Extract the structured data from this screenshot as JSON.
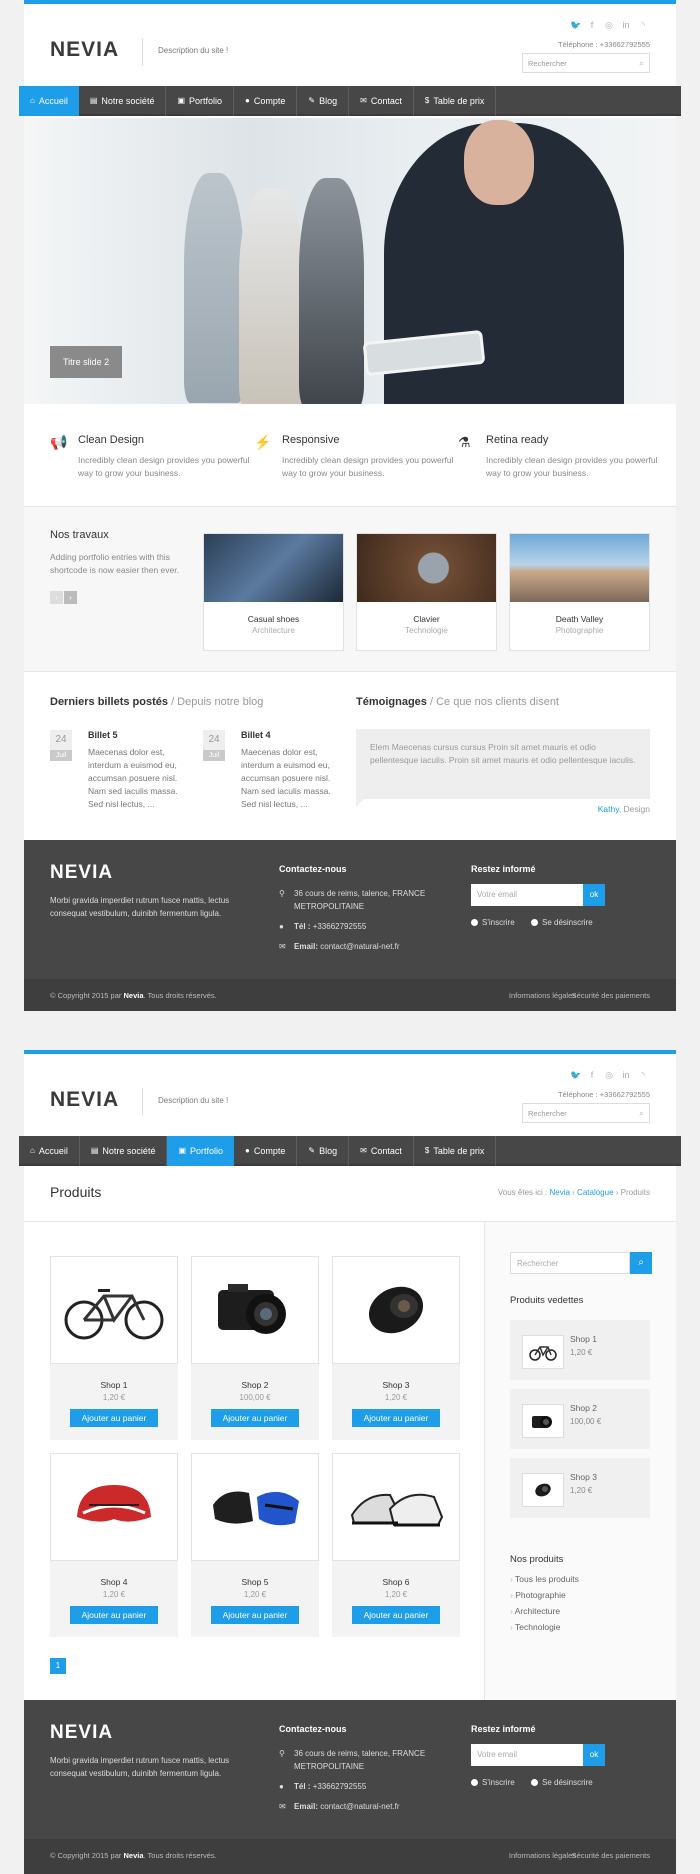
{
  "site": {
    "logo": "NEVIA",
    "description": "Description du site !",
    "phone": "Téléphone : +33662792555",
    "search_placeholder": "Rechercher"
  },
  "social_icons": [
    "twitter-icon",
    "facebook-icon",
    "dribbble-icon",
    "linkedin-icon",
    "rss-icon"
  ],
  "nav": {
    "items": [
      {
        "icon": "home-icon",
        "label": "Accueil"
      },
      {
        "icon": "file-icon",
        "label": "Notre société"
      },
      {
        "icon": "briefcase-icon",
        "label": "Portfolio"
      },
      {
        "icon": "user-icon",
        "label": "Compte"
      },
      {
        "icon": "pencil-icon",
        "label": "Blog"
      },
      {
        "icon": "envelope-icon",
        "label": "Contact"
      },
      {
        "icon": "dollar-icon",
        "label": "Table de prix"
      }
    ],
    "active_page1": "Accueil",
    "active_page2": "Portfolio"
  },
  "hero": {
    "slide_title": "Titre slide 2"
  },
  "features": [
    {
      "icon": "megaphone-icon",
      "title": "Clean Design",
      "text": "Incredibly clean design provides you powerful way to grow your business."
    },
    {
      "icon": "magic-wand-icon",
      "title": "Responsive",
      "text": "Incredibly clean design provides you powerful way to grow your business."
    },
    {
      "icon": "flask-icon",
      "title": "Retina ready",
      "text": "Incredibly clean design provides you powerful way to grow your business."
    }
  ],
  "portfolio": {
    "title": "Nos travaux",
    "text": "Adding portfolio entries with this shortcode is now easier then ever.",
    "items": [
      {
        "title": "Casual shoes",
        "category": "Architecture"
      },
      {
        "title": "Clavier",
        "category": "Technologie"
      },
      {
        "title": "Death Valley",
        "category": "Photographie"
      }
    ]
  },
  "blog": {
    "title": "Derniers billets postés",
    "subtitle": "/ Depuis notre blog",
    "posts": [
      {
        "day": "24",
        "month": "Juil",
        "title": "Billet 5",
        "excerpt": "Maecenas dolor est, interdum a euismod eu, accumsan posuere nisl. Nam sed iaculis massa. Sed nisl lectus, ..."
      },
      {
        "day": "24",
        "month": "Juil",
        "title": "Billet 4",
        "excerpt": "Maecenas dolor est, interdum a euismod eu, accumsan posuere nisl. Nam sed iaculis massa. Sed nisl lectus, ..."
      }
    ]
  },
  "testimonials": {
    "title": "Témoignages",
    "subtitle": "/ Ce que nos clients disent",
    "quote": "Elem Maecenas cursus cursus Proin sit amet mauris et odio pellentesque iaculis. Proin sit amet mauris et odio pellentesque iaculis.",
    "author": "Kathy",
    "role": ", Design"
  },
  "footer": {
    "logo": "NEVIA",
    "about": "Morbi gravida imperdiet rutrum fusce mattis, lectus consequat vestibulum, duinibh fermentum ligula.",
    "contact_title": "Contactez-nous",
    "address": "36 cours de reims, talence, FRANCE METROPOLITAINE",
    "tel_label": "Tél :",
    "tel": "+33662792555",
    "email_label": "Email:",
    "email": "contact@natural-net.fr",
    "news_title": "Restez informé",
    "email_placeholder": "Votre email",
    "ok": "ok",
    "subscribe": "S'inscrire",
    "unsubscribe": "Se désinscrire",
    "copyright_pre": "© Copyright 2015 par",
    "copyright_brand": "Nevia",
    "copyright_post": ". Tous droits réservés.",
    "legal": "Informations légales",
    "payments": "Sécurité des paiements"
  },
  "products_page": {
    "title": "Produits",
    "breadcrumb_label": "Vous êtes ici :",
    "breadcrumb": [
      "Nevia",
      "Catalogue",
      "Produits"
    ],
    "search_placeholder": "Rechercher",
    "add_label": "Ajouter au panier",
    "products": [
      {
        "name": "Shop 1",
        "price": "1,20 €",
        "icon": "bicycle-icon"
      },
      {
        "name": "Shop 2",
        "price": "100,00 €",
        "icon": "camera-icon"
      },
      {
        "name": "Shop 3",
        "price": "1,20 €",
        "icon": "lens-icon"
      },
      {
        "name": "Shop 4",
        "price": "1,20 €",
        "icon": "helmet-icon"
      },
      {
        "name": "Shop 5",
        "price": "1,20 €",
        "icon": "gloves-icon"
      },
      {
        "name": "Shop 6",
        "price": "1,20 €",
        "icon": "shoes-icon"
      }
    ],
    "featured_title": "Produits vedettes",
    "featured": [
      {
        "name": "Shop 1",
        "price": "1,20 €"
      },
      {
        "name": "Shop 2",
        "price": "100,00 €"
      },
      {
        "name": "Shop 3",
        "price": "1,20 €"
      }
    ],
    "categories_title": "Nos produits",
    "categories": [
      "Tous les produits",
      "Photographie",
      "Architecture",
      "Technologie"
    ],
    "page": "1"
  }
}
